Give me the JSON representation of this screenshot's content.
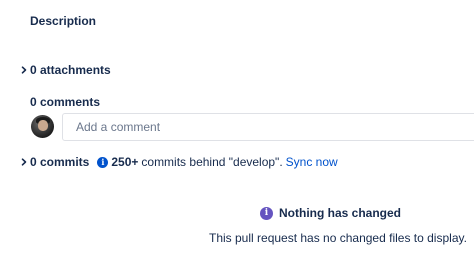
{
  "description": {
    "title": "Description"
  },
  "attachments": {
    "label": "0 attachments"
  },
  "comments": {
    "title": "0 comments",
    "placeholder": "Add a comment"
  },
  "commits": {
    "label": "0 commits",
    "behind_count": "250+",
    "behind_text": "commits behind \"develop\".",
    "sync_label": "Sync now"
  },
  "empty_state": {
    "title": "Nothing has changed",
    "message": "This pull request has no changed files to display."
  },
  "icons": {
    "expander": "chevron-right-icon",
    "info": "info-icon",
    "empty": "info-icon"
  },
  "colors": {
    "text": "#172b4d",
    "link": "#0052cc",
    "info_blue": "#0052cc",
    "info_purple": "#6554c0",
    "placeholder": "#6b778c",
    "border": "#dfe1e6"
  }
}
